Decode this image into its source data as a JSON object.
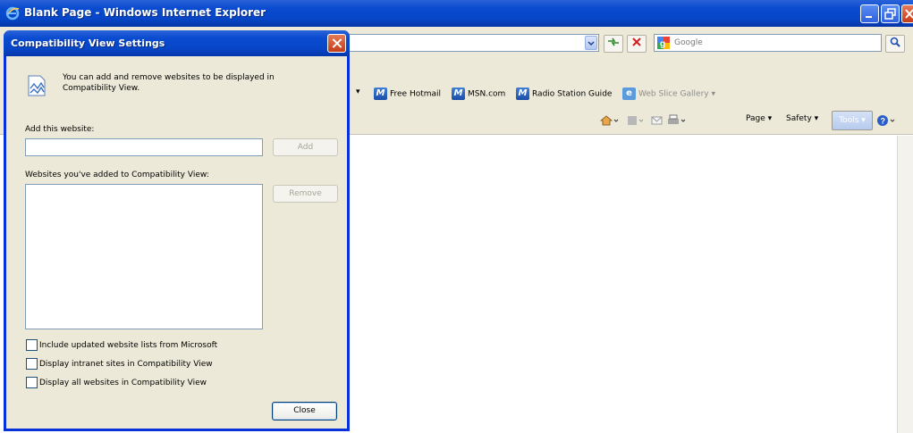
{
  "ie_window": {
    "title": "Blank Page - Windows Internet Explorer",
    "search_placeholder": "Google",
    "favorites": [
      {
        "label": "Free Hotmail"
      },
      {
        "label": "MSN.com"
      },
      {
        "label": "Radio Station Guide"
      },
      {
        "label": "Web Slice Gallery"
      }
    ],
    "command_bar": {
      "page_label": "Page",
      "safety_label": "Safety",
      "tools_label": "Tools"
    }
  },
  "dialog": {
    "title": "Compatibility View Settings",
    "intro_text": "You can add and remove websites to be displayed in Compatibility View.",
    "add_website_label": "Add this website:",
    "add_website_value": "",
    "add_button_label": "Add",
    "list_label": "Websites you've added to Compatibility View:",
    "remove_button_label": "Remove",
    "checkboxes": [
      {
        "label": "Include updated website lists from Microsoft",
        "checked": false
      },
      {
        "label": "Display intranet sites in Compatibility View",
        "checked": false
      },
      {
        "label": "Display all websites in Compatibility View",
        "checked": false
      }
    ],
    "close_button_label": "Close"
  },
  "colors": {
    "titlebar_blue": "#0a4bd0",
    "dialog_face": "#ece9d8",
    "close_red": "#c43c18"
  }
}
